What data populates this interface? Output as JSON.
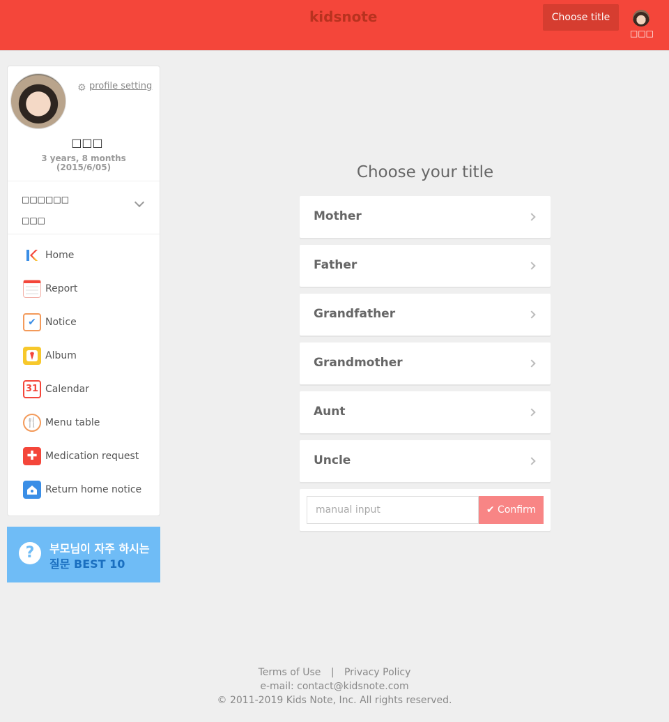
{
  "header": {
    "logo": "kidsnote",
    "choose_title_button": "Choose title",
    "user_name": "□□□",
    "accent_color": "#f4463a"
  },
  "sidebar": {
    "profile_setting": "profile setting",
    "child_name": "□□□",
    "child_age_line1": "3 years, 8 months",
    "child_age_line2": "(2015/6/05)",
    "school": "□□□□□□",
    "class": "□□□",
    "items": [
      {
        "label": "Home",
        "icon": "home-icon"
      },
      {
        "label": "Report",
        "icon": "report-icon"
      },
      {
        "label": "Notice",
        "icon": "notice-icon"
      },
      {
        "label": "Album",
        "icon": "album-icon"
      },
      {
        "label": "Calendar",
        "icon": "calendar-icon",
        "icon_text": "31"
      },
      {
        "label": "Menu table",
        "icon": "menu-table-icon"
      },
      {
        "label": "Medication request",
        "icon": "medication-icon"
      },
      {
        "label": "Return home notice",
        "icon": "return-home-icon"
      }
    ]
  },
  "banner": {
    "line1": "부모님이 자주 하시는",
    "line2": "질문 BEST 10",
    "icon": "question-icon"
  },
  "main": {
    "title": "Choose your title",
    "options": [
      "Mother",
      "Father",
      "Grandfather",
      "Grandmother",
      "Aunt",
      "Uncle"
    ],
    "manual_input_placeholder": "manual input",
    "confirm_label": "Confirm"
  },
  "footer": {
    "terms": "Terms of Use",
    "separator": "|",
    "privacy": "Privacy Policy",
    "email": "e-mail: contact@kidsnote.com",
    "copyright": "© 2011-2019 Kids Note, Inc. All rights reserved."
  }
}
